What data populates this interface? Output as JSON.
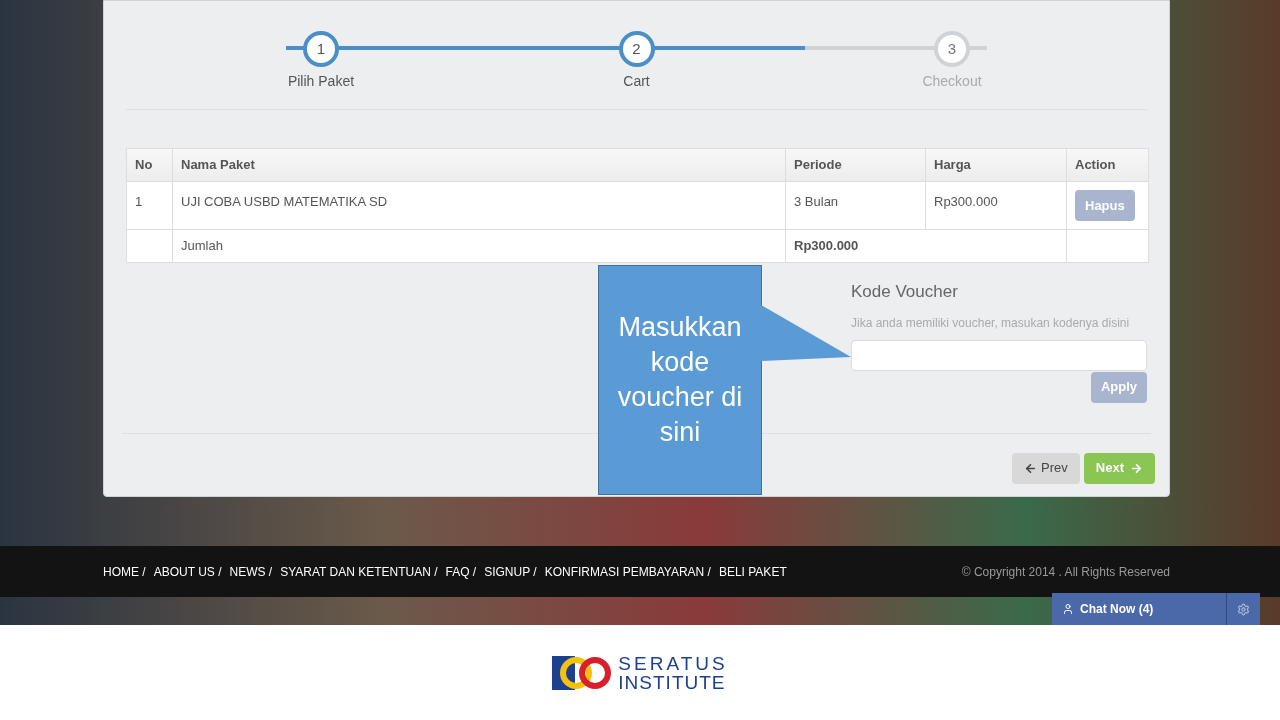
{
  "steps": [
    {
      "number": "1",
      "label": "Pilih Paket",
      "completed": true
    },
    {
      "number": "2",
      "label": "Cart",
      "completed": true
    },
    {
      "number": "3",
      "label": "Checkout",
      "completed": false
    }
  ],
  "progress": {
    "level": 0.74
  },
  "table": {
    "columns": [
      "No",
      "Nama Paket",
      "Periode",
      "Harga",
      "Action"
    ],
    "rows": [
      {
        "no": "1",
        "name": "UJI COBA USBD MATEMATIKA SD",
        "period": "3 Bulan",
        "price": "Rp300.000",
        "action": "Hapus"
      }
    ],
    "total": {
      "label": "Jumlah",
      "value": "Rp300.000"
    }
  },
  "voucher": {
    "title": "Kode Voucher",
    "help": "Jika anda memiliki voucher, masukan kodenya disini",
    "apply": "Apply"
  },
  "nav": {
    "prev": "Prev",
    "next": "Next"
  },
  "callout": "Masukkan kode voucher di sini",
  "footer": {
    "links": [
      "HOME /",
      "ABOUT US /",
      "NEWS /",
      "SYARAT DAN KETENTUAN /",
      "FAQ /",
      "SIGNUP /",
      "KONFIRMASI PEMBAYARAN /",
      "BELI PAKET"
    ],
    "copyright": "© Copyright 2014 . All Rights Reserved"
  },
  "chat": {
    "label": "Chat Now (4)"
  },
  "logo": {
    "line1": "SERATUS",
    "line2": "INSTITUTE"
  }
}
